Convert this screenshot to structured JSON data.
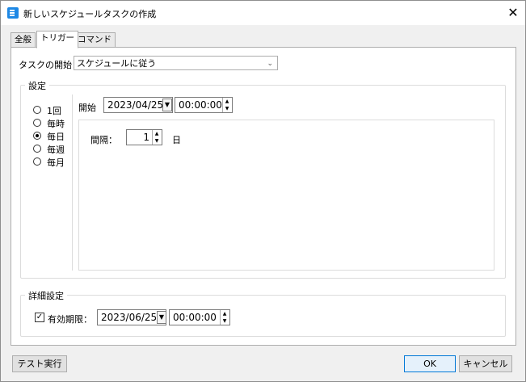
{
  "window": {
    "title": "新しいスケジュールタスクの作成",
    "close_label": "✕"
  },
  "tabs": [
    {
      "label": "全般"
    },
    {
      "label": "トリガー",
      "active": true
    },
    {
      "label": "コマンド"
    }
  ],
  "task_start": {
    "label": "タスクの開始：",
    "selected": "スケジュールに従う"
  },
  "settings_group": {
    "legend": "設定",
    "frequency_options": [
      {
        "label": "1回",
        "checked": false
      },
      {
        "label": "毎時",
        "checked": false
      },
      {
        "label": "毎日",
        "checked": true
      },
      {
        "label": "毎週",
        "checked": false
      },
      {
        "label": "毎月",
        "checked": false
      }
    ],
    "start_label": "開始",
    "start_date": "2023/04/25",
    "start_time": "00:00:00",
    "interval_label": "間隔：",
    "interval_value": "1",
    "interval_unit": "日"
  },
  "advanced_group": {
    "legend": "詳細設定",
    "expiry_label": "有効期限：",
    "expiry_checked": true,
    "expiry_date": "2023/06/25",
    "expiry_time": "00:00:00"
  },
  "buttons": {
    "test_run": "テスト実行",
    "ok": "OK",
    "cancel": "キャンセル"
  },
  "icons": {
    "app": "app-icon",
    "close": "close-icon",
    "dropdown": "chevron-down-icon",
    "spin": "spin-updown-icon"
  }
}
